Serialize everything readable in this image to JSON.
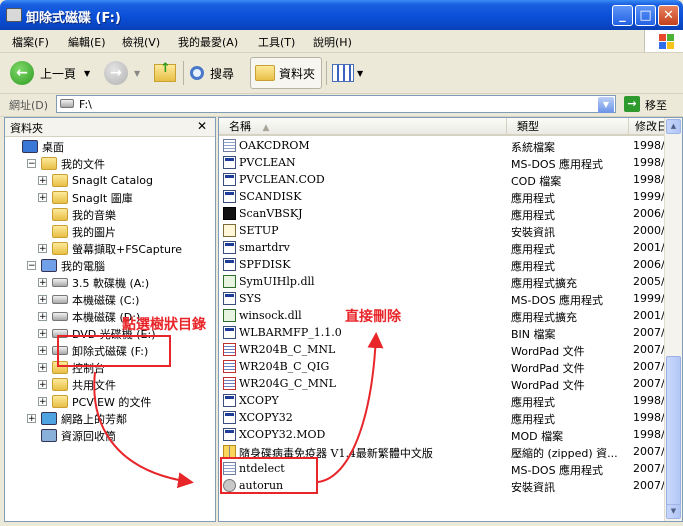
{
  "window": {
    "title": "卸除式磁碟 (F:)"
  },
  "menu": [
    "檔案(F)",
    "編輯(E)",
    "檢視(V)",
    "我的最愛(A)",
    "工具(T)",
    "說明(H)"
  ],
  "toolbar": {
    "back_label": "上一頁",
    "search_label": "搜尋",
    "folders_label": "資料夾"
  },
  "address": {
    "label": "網址(D)",
    "value": "F:\\",
    "go_label": "移至"
  },
  "folder_pane": {
    "title": "資料夾",
    "close_glyph": "✕",
    "items": [
      {
        "label": "桌面",
        "indent": 0,
        "expander": "",
        "icon": "desktop"
      },
      {
        "label": "我的文件",
        "indent": 1,
        "expander": "−",
        "icon": "folder"
      },
      {
        "label": "SnagIt Catalog",
        "indent": 2,
        "expander": "+",
        "icon": "folder"
      },
      {
        "label": "SnagIt 圖庫",
        "indent": 2,
        "expander": "+",
        "icon": "folder"
      },
      {
        "label": "我的音樂",
        "indent": 2,
        "expander": "",
        "icon": "folder"
      },
      {
        "label": "我的圖片",
        "indent": 2,
        "expander": "",
        "icon": "folder"
      },
      {
        "label": "螢幕擷取+FSCapture",
        "indent": 2,
        "expander": "+",
        "icon": "folder"
      },
      {
        "label": "我的電腦",
        "indent": 1,
        "expander": "−",
        "icon": "computer"
      },
      {
        "label": "3.5 軟碟機 (A:)",
        "indent": 2,
        "expander": "+",
        "icon": "drive"
      },
      {
        "label": "本機磁碟 (C:)",
        "indent": 2,
        "expander": "+",
        "icon": "drive"
      },
      {
        "label": "本機磁碟 (D:)",
        "indent": 2,
        "expander": "+",
        "icon": "drive"
      },
      {
        "label": "DVD 光碟機 (E:)",
        "indent": 2,
        "expander": "+",
        "icon": "drive"
      },
      {
        "label": "卸除式磁碟 (F:)",
        "indent": 2,
        "expander": "+",
        "icon": "drive"
      },
      {
        "label": "控制台",
        "indent": 2,
        "expander": "+",
        "icon": "folder"
      },
      {
        "label": "共用文件",
        "indent": 2,
        "expander": "+",
        "icon": "folder"
      },
      {
        "label": "PCVIEW 的文件",
        "indent": 2,
        "expander": "+",
        "icon": "folder"
      },
      {
        "label": "網路上的芳鄰",
        "indent": 1,
        "expander": "+",
        "icon": "network"
      },
      {
        "label": "資源回收筒",
        "indent": 1,
        "expander": "",
        "icon": "recycle"
      }
    ]
  },
  "file_list": {
    "columns": [
      "名稱",
      "類型",
      "修改日"
    ],
    "sort_arrow": "▲",
    "rows": [
      {
        "name": "OAKCDROM",
        "type": "系統檔案",
        "date": "1998/1",
        "icon": "doc"
      },
      {
        "name": "PVCLEAN",
        "type": "MS-DOS 應用程式",
        "date": "1998/2",
        "icon": "app"
      },
      {
        "name": "PVCLEAN.COD",
        "type": "COD 檔案",
        "date": "1998/2",
        "icon": "app"
      },
      {
        "name": "SCANDISK",
        "type": "應用程式",
        "date": "1999/5",
        "icon": "app"
      },
      {
        "name": "ScanVBSKJ",
        "type": "應用程式",
        "date": "2006/9",
        "icon": "dark"
      },
      {
        "name": "SETUP",
        "type": "安裝資訊",
        "date": "2000/1",
        "icon": "inf"
      },
      {
        "name": "smartdrv",
        "type": "應用程式",
        "date": "2001/3",
        "icon": "app"
      },
      {
        "name": "SPFDISK",
        "type": "應用程式",
        "date": "2006/9",
        "icon": "app"
      },
      {
        "name": "SymUIHlp.dll",
        "type": "應用程式擴充",
        "date": "2005/9",
        "icon": "dll"
      },
      {
        "name": "SYS",
        "type": "MS-DOS 應用程式",
        "date": "1999/5",
        "icon": "app"
      },
      {
        "name": "winsock.dll",
        "type": "應用程式擴充",
        "date": "2001/4",
        "icon": "dll"
      },
      {
        "name": "WLBARMFP_1.1.0",
        "type": "BIN 檔案",
        "date": "2007/1",
        "icon": "app"
      },
      {
        "name": "WR204B_C_MNL",
        "type": "WordPad 文件",
        "date": "2007/9",
        "icon": "wp"
      },
      {
        "name": "WR204B_C_QIG",
        "type": "WordPad 文件",
        "date": "2007/4",
        "icon": "wp"
      },
      {
        "name": "WR204G_C_MNL",
        "type": "WordPad 文件",
        "date": "2007/9",
        "icon": "wp"
      },
      {
        "name": "XCOPY",
        "type": "應用程式",
        "date": "1998/6",
        "icon": "app"
      },
      {
        "name": "XCOPY32",
        "type": "應用程式",
        "date": "1998/6",
        "icon": "app"
      },
      {
        "name": "XCOPY32.MOD",
        "type": "MOD 檔案",
        "date": "1998/6",
        "icon": "app"
      },
      {
        "name": "隨身碟病毒免疫器 V1.4最新繁體中文版",
        "type": "壓縮的 (zipped) 資...",
        "date": "2007/1",
        "icon": "zip"
      },
      {
        "name": "ntdelect",
        "type": "MS-DOS 應用程式",
        "date": "2007/1",
        "icon": "doc"
      },
      {
        "name": "autorun",
        "type": "安裝資訊",
        "date": "2007/1",
        "icon": "gear"
      }
    ]
  },
  "annotations": {
    "left": "點選樹狀目錄",
    "right": "直接刪除"
  },
  "colors": {
    "annotation": "#e8262a",
    "titlebar": "#0a4fd8"
  }
}
